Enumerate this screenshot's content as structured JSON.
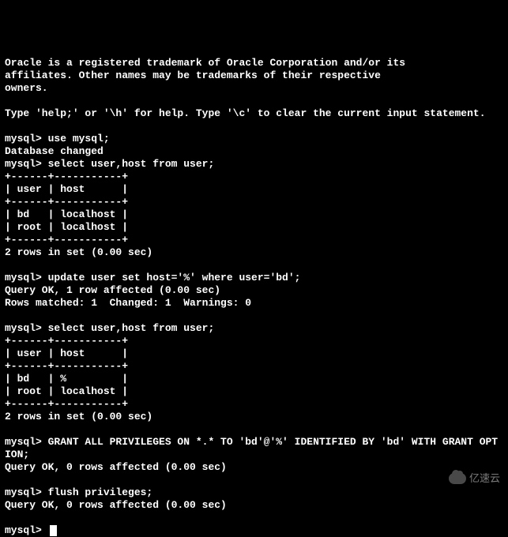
{
  "intro": {
    "trademark_line1": "Oracle is a registered trademark of Oracle Corporation and/or its",
    "trademark_line2": "affiliates. Other names may be trademarks of their respective",
    "trademark_line3": "owners.",
    "help_line": "Type 'help;' or '\\h' for help. Type '\\c' to clear the current input statement."
  },
  "session": {
    "prompt": "mysql> ",
    "cmd_use": "use mysql;",
    "resp_db_changed": "Database changed",
    "cmd_select1": "select user,host from user;",
    "table1_border": "+------+-----------+",
    "table1_header": "| user | host      |",
    "table1_row1": "| bd   | localhost |",
    "table1_row2": "| root | localhost |",
    "resp_rows1": "2 rows in set (0.00 sec)",
    "cmd_update": "update user set host='%' where user='bd';",
    "resp_query1": "Query OK, 1 row affected (0.00 sec)",
    "resp_matched": "Rows matched: 1  Changed: 1  Warnings: 0",
    "cmd_select2": "select user,host from user;",
    "table2_border": "+------+-----------+",
    "table2_header": "| user | host      |",
    "table2_row1": "| bd   | %         |",
    "table2_row2": "| root | localhost |",
    "resp_rows2": "2 rows in set (0.00 sec)",
    "cmd_grant_line1": "GRANT ALL PRIVILEGES ON *.* TO 'bd'@'%' IDENTIFIED BY 'bd' WITH GRANT OPT",
    "cmd_grant_line2": "ION;",
    "resp_query2": "Query OK, 0 rows affected (0.00 sec)",
    "cmd_flush": "flush privileges;",
    "resp_query3": "Query OK, 0 rows affected (0.00 sec)"
  },
  "watermark": "亿速云"
}
